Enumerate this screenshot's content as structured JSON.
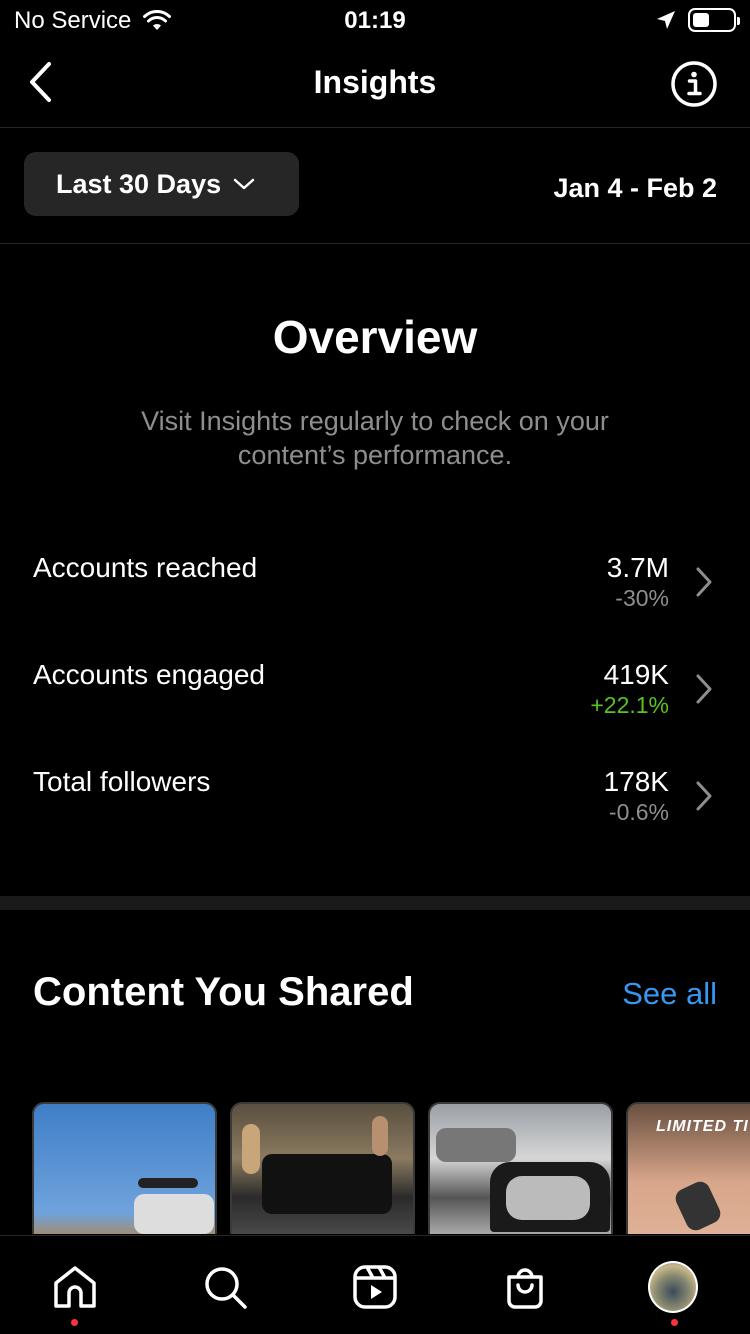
{
  "status_bar": {
    "carrier": "No Service",
    "time": "01:19",
    "wifi_icon": "wifi-icon",
    "location_icon": "location-arrow-icon",
    "battery_icon": "battery-icon"
  },
  "header": {
    "title": "Insights",
    "back_icon": "chevron-left-icon",
    "info_icon": "info-icon"
  },
  "filter": {
    "range_label": "Last 30 Days",
    "date_range": "Jan 4 - Feb 2"
  },
  "overview": {
    "title": "Overview",
    "description": "Visit Insights regularly to check on your content’s performance.",
    "metrics": [
      {
        "label": "Accounts reached",
        "value": "3.7M",
        "change": "-30%"
      },
      {
        "label": "Accounts engaged",
        "value": "419K",
        "change": "+22.1%"
      },
      {
        "label": "Total followers",
        "value": "178K",
        "change": "-0.6%"
      }
    ]
  },
  "content_shared": {
    "title": "Content You Shared",
    "see_all": "See all",
    "thumb_4_text": "LIMITED TI"
  },
  "tab_bar": {
    "items": [
      "home-icon",
      "search-icon",
      "reels-icon",
      "shop-icon",
      "profile-avatar"
    ]
  },
  "colors": {
    "background": "#000000",
    "secondary_text": "#8e8e8e",
    "positive": "#58c322",
    "link": "#3897f0",
    "notification_dot": "#ff3040"
  }
}
